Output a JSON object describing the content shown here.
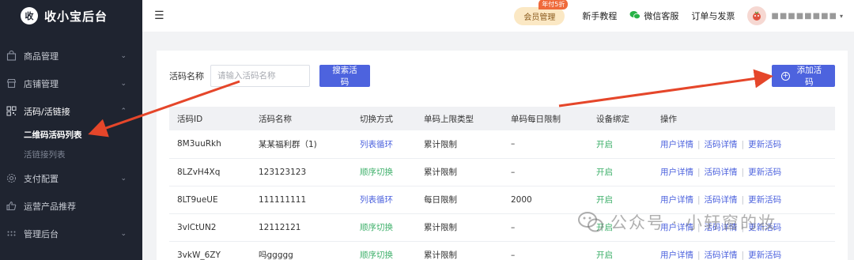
{
  "brand": {
    "logo_char": "收",
    "name": "收小宝后台"
  },
  "sidebar": {
    "items": [
      {
        "label": "商品管理",
        "icon": "bag-icon",
        "arrow": "⌄"
      },
      {
        "label": "店铺管理",
        "icon": "store-icon",
        "arrow": "⌄"
      },
      {
        "label": "活码/活链接",
        "icon": "qrcode-icon",
        "arrow": "⌃"
      },
      {
        "label": "支付配置",
        "icon": "gear-icon",
        "arrow": "⌄"
      },
      {
        "label": "运营产品推荐",
        "icon": "thumbs-up-icon",
        "arrow": ""
      },
      {
        "label": "管理后台",
        "icon": "grid-icon",
        "arrow": "⌄"
      }
    ],
    "sub_items": [
      "二维码活码列表",
      "活链接列表"
    ]
  },
  "header": {
    "menu_icon": "☰",
    "vip_label": "会员管理",
    "vip_badge": "年付5折",
    "links": [
      "新手教程",
      "微信客服",
      "订单与发票"
    ],
    "user_name": "■■■■■■■■"
  },
  "search": {
    "label": "活码名称",
    "placeholder": "请输入活码名称",
    "button": "搜索活码",
    "add_button": "添加活码"
  },
  "table": {
    "headers": [
      "活码ID",
      "活码名称",
      "切换方式",
      "单码上限类型",
      "单码每日限制",
      "设备绑定",
      "操作"
    ],
    "rows": [
      {
        "id": "8M3uuRkh",
        "name": "某某福利群（1)",
        "mode": "列表循环",
        "mode_color": "#4d63de",
        "limit_type": "累计限制",
        "daily": "–",
        "device": "开启"
      },
      {
        "id": "8LZvH4Xq",
        "name": "123123123",
        "mode": "顺序切换",
        "mode_color": "#3fb06b",
        "limit_type": "累计限制",
        "daily": "–",
        "device": "开启"
      },
      {
        "id": "8LT9ueUE",
        "name": "111111111",
        "mode": "列表循环",
        "mode_color": "#4d63de",
        "limit_type": "每日限制",
        "daily": "2000",
        "device": "开启"
      },
      {
        "id": "3vlCtUN2",
        "name": "12112121",
        "mode": "顺序切换",
        "mode_color": "#3fb06b",
        "limit_type": "累计限制",
        "daily": "–",
        "device": "开启"
      },
      {
        "id": "3vkW_6ZY",
        "name": "吗ggggg",
        "mode": "顺序切换",
        "mode_color": "#3fb06b",
        "limit_type": "累计限制",
        "daily": "–",
        "device": "开启"
      }
    ],
    "actions": [
      "用户详情",
      "活码详情",
      "更新活码"
    ],
    "action_separator": "|"
  },
  "watermark": "公众号 · 小轩窗的妆",
  "colors": {
    "sidebar_bg": "#1f2430",
    "primary": "#4d63de",
    "green": "#3fb06b",
    "arrow": "#e5462a"
  }
}
